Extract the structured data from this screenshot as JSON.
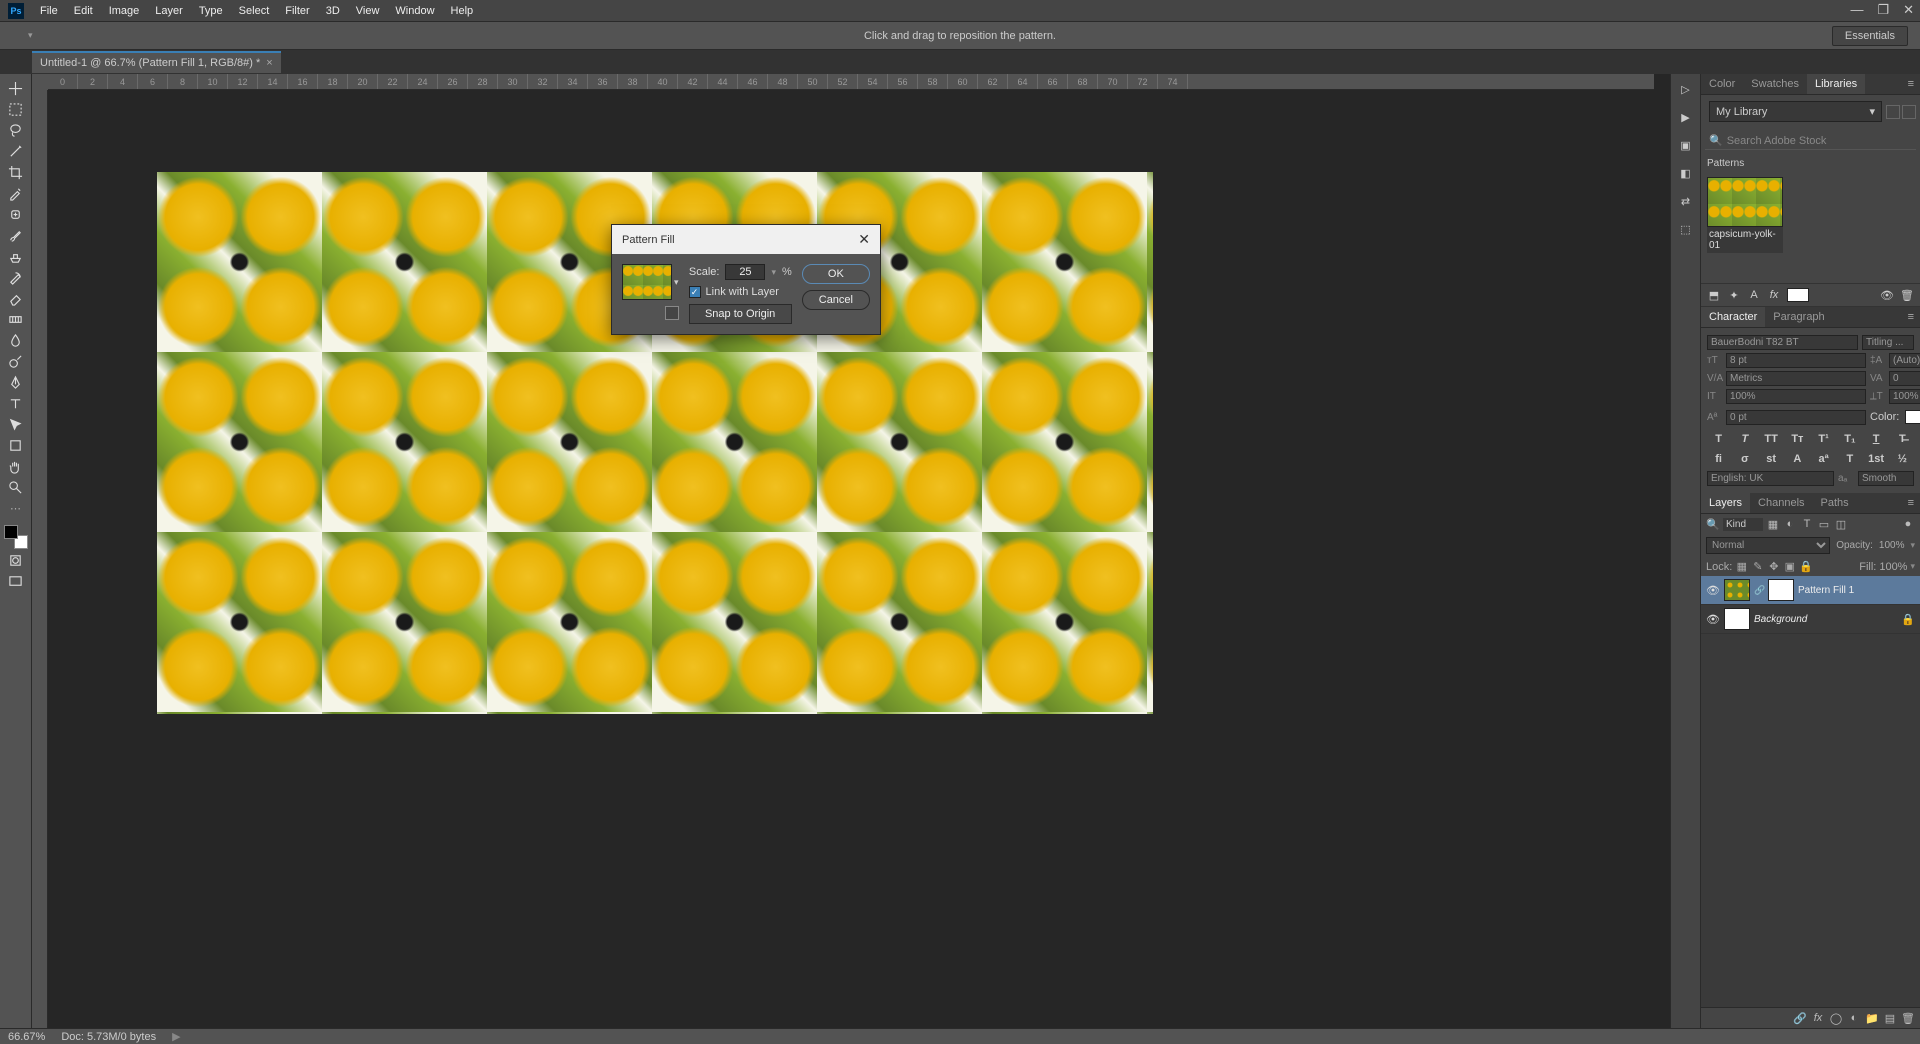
{
  "menu": [
    "File",
    "Edit",
    "Image",
    "Layer",
    "Type",
    "Select",
    "Filter",
    "3D",
    "View",
    "Window",
    "Help"
  ],
  "options_hint": "Click and drag to reposition the pattern.",
  "workspace_label": "Essentials",
  "doc_tab": "Untitled-1 @ 66.7% (Pattern Fill 1, RGB/8#) *",
  "ruler_marks": [
    "0",
    "2",
    "4",
    "6",
    "8",
    "10",
    "12",
    "14",
    "16",
    "18",
    "20",
    "22",
    "24",
    "26",
    "28",
    "30",
    "32",
    "34",
    "36",
    "38",
    "40",
    "42",
    "44",
    "46",
    "48",
    "50",
    "52",
    "54",
    "56",
    "58",
    "60",
    "62",
    "64",
    "66",
    "68",
    "70",
    "72",
    "74"
  ],
  "status": {
    "zoom": "66.67%",
    "doc": "Doc: 5.73M/0 bytes"
  },
  "dialog": {
    "title": "Pattern Fill",
    "scale_label": "Scale:",
    "scale_value": "25",
    "scale_unit": "%",
    "link_label": "Link with Layer",
    "link_checked": true,
    "snap_label": "Snap to Origin",
    "ok": "OK",
    "cancel": "Cancel"
  },
  "panels": {
    "top_tabs": [
      "Color",
      "Swatches",
      "Libraries"
    ],
    "library_name": "My Library",
    "search_placeholder": "Search Adobe Stock",
    "section_head": "Patterns",
    "pattern_name": "capsicum-yolk-01",
    "char_tabs": [
      "Character",
      "Paragraph"
    ],
    "font_family": "BauerBodni T82 BT",
    "font_style": "Titling ...",
    "font_size": "8 pt",
    "leading": "(Auto)",
    "kerning": "Metrics",
    "tracking": "0",
    "vscale": "100%",
    "hscale": "100%",
    "baseline": "0 pt",
    "color_label": "Color:",
    "lang": "English: UK",
    "aa": "Smooth",
    "layer_tabs": [
      "Layers",
      "Channels",
      "Paths"
    ],
    "layer_kind_placeholder": "Kind",
    "blend": "Normal",
    "opacity_label": "Opacity:",
    "opacity_val": "100%",
    "lock_label": "Lock:",
    "fill_label": "Fill:",
    "fill_val": "100%",
    "layers": [
      {
        "name": "Pattern Fill 1",
        "selected": true,
        "pattern": true,
        "mask": true
      },
      {
        "name": "Background",
        "selected": false,
        "pattern": false,
        "locked": true
      }
    ]
  }
}
